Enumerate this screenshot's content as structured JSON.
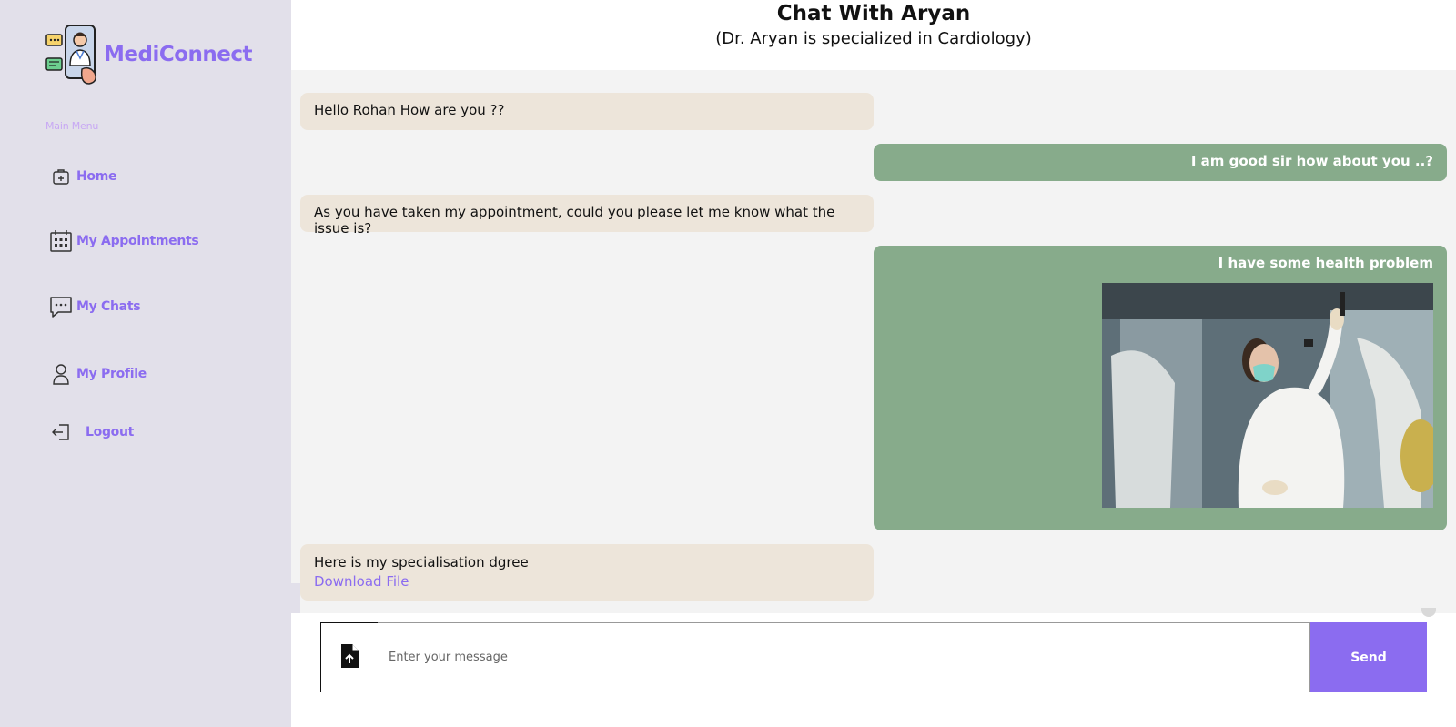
{
  "app": {
    "brand": "MediConnect",
    "accent_color": "#8b6cf0"
  },
  "sidebar": {
    "menu_heading": "Main Menu",
    "items": [
      {
        "label": "Home",
        "icon": "home-medical-icon"
      },
      {
        "label": "My Appointments",
        "icon": "calendar-icon"
      },
      {
        "label": "My Chats",
        "icon": "chat-bubble-icon"
      },
      {
        "label": "My Profile",
        "icon": "user-icon"
      },
      {
        "label": "Logout",
        "icon": "logout-icon"
      }
    ]
  },
  "header": {
    "title": "Chat With Aryan",
    "subtitle": "(Dr. Aryan is specialized in Cardiology)"
  },
  "messages": [
    {
      "side": "left",
      "text": "Hello Rohan How are you ??"
    },
    {
      "side": "right",
      "text": "I am good sir how about you ..?"
    },
    {
      "side": "left",
      "text": "As you have taken my appointment, could you please let me know what the issue is?"
    },
    {
      "side": "right",
      "text": "I have some health problem",
      "has_image": true
    },
    {
      "side": "left",
      "text": "Here is my specialisation dgree",
      "link_label": "Download File"
    }
  ],
  "composer": {
    "placeholder": "Enter your message",
    "value": "",
    "send_label": "Send",
    "attach_icon": "file-upload-icon"
  },
  "colors": {
    "sidebar_bg": "#e2e0ea",
    "incoming_bubble": "#ede5da",
    "outgoing_bubble": "#87ab8b"
  }
}
